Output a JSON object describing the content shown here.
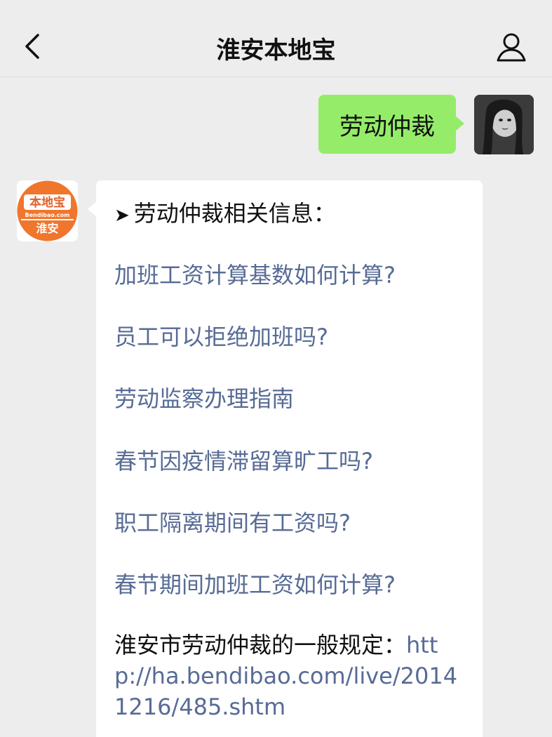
{
  "header": {
    "title": "淮安本地宝",
    "back_icon": "chevron-left-icon",
    "profile_icon": "person-icon"
  },
  "outgoing": {
    "text": "劳动仲裁"
  },
  "bot": {
    "logo_top": "本地宝",
    "logo_site": "Bendibao.com",
    "logo_city": "淮安",
    "heading_arrow": "➤",
    "heading": "劳动仲裁相关信息：",
    "links": [
      "加班工资计算基数如何计算?",
      "员工可以拒绝加班吗?",
      "劳动监察办理指南",
      "春节因疫情滞留算旷工吗?",
      "职工隔离期间有工资吗?",
      "春节期间加班工资如何计算?"
    ],
    "rule_prefix": "淮安市劳动仲裁的一般规定：",
    "rule_url": "http://ha.bendibao.com/live/20141216/485.shtm"
  },
  "colors": {
    "bubble_green": "#95ec69",
    "link_blue": "#576b95",
    "logo_orange": "#f0762d"
  }
}
